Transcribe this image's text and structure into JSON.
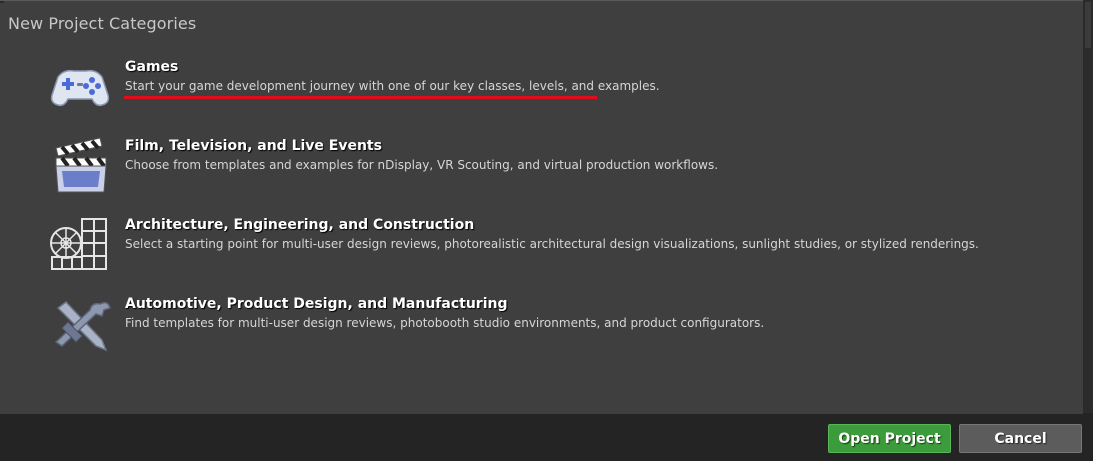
{
  "panel": {
    "title": "New Project Categories"
  },
  "categories": [
    {
      "title": "Games",
      "description": "Start your game development journey with one of our key classes, levels, and examples.",
      "icon": "gamepad-icon"
    },
    {
      "title": "Film, Television, and Live Events",
      "description": "Choose from templates and examples for nDisplay, VR Scouting, and virtual production workflows.",
      "icon": "clapperboard-icon"
    },
    {
      "title": "Architecture, Engineering, and Construction",
      "description": "Select a starting point for multi-user design reviews, photorealistic architectural design visualizations, sunlight studies, or stylized renderings.",
      "icon": "window-grid-icon"
    },
    {
      "title": "Automotive, Product Design, and Manufacturing",
      "description": "Find templates for multi-user design reviews, photobooth studio environments, and product configurators.",
      "icon": "tools-icon"
    }
  ],
  "footer": {
    "open_label": "Open Project",
    "cancel_label": "Cancel"
  },
  "colors": {
    "panel": "#3f3f3f",
    "background": "#242424",
    "open_button": "#3c9b3a",
    "cancel_button": "#5c5c5c",
    "highlight_underline": "#e00d1c"
  }
}
